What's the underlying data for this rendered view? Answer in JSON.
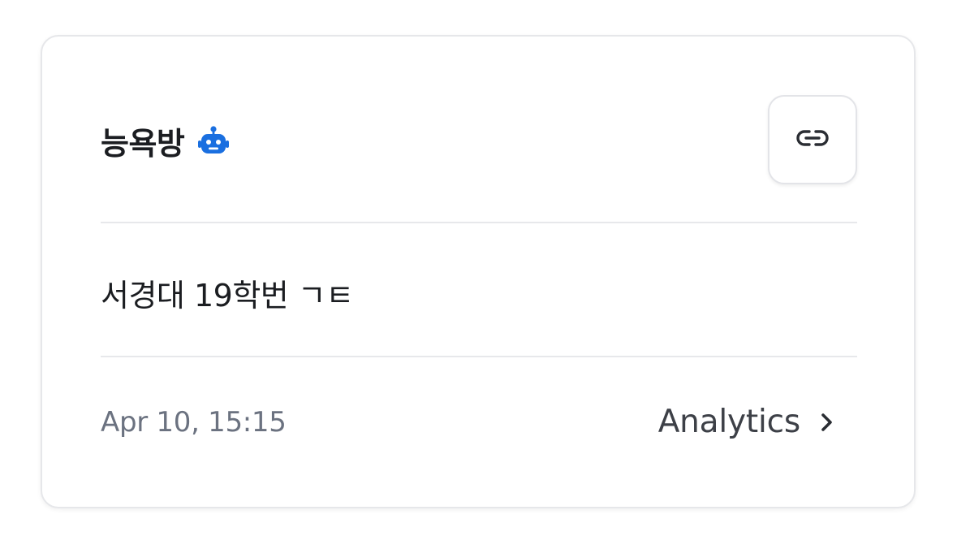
{
  "card": {
    "title": "능욕방",
    "title_icon": "robot-icon",
    "link_button_icon": "link-icon",
    "description": "서경대 19학번 ㄱㅌ",
    "timestamp": "Apr 10, 15:15",
    "analytics_label": "Analytics",
    "analytics_icon": "chevron-right-icon"
  },
  "colors": {
    "accent": "#1a6fe0",
    "text_primary": "#1b1d21",
    "text_secondary": "#6b7280",
    "divider": "#e7e8eb"
  }
}
